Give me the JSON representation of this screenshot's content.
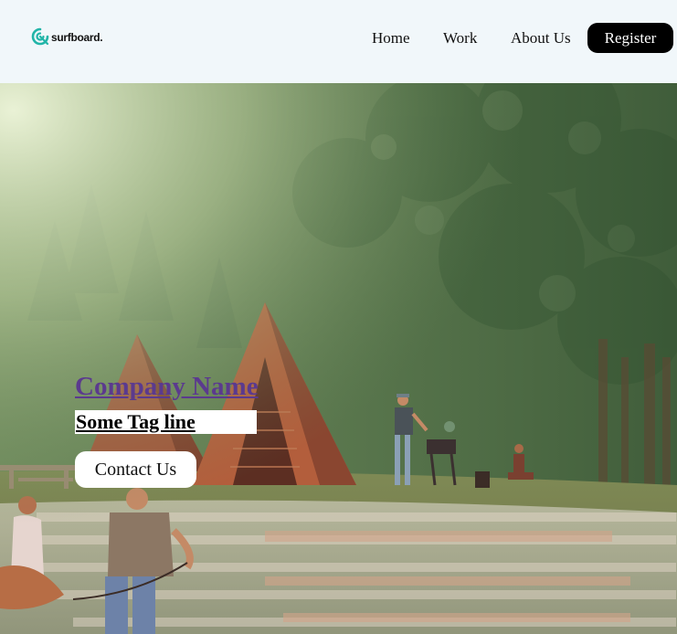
{
  "header": {
    "logo_text": "surfboard.",
    "nav": {
      "home": "Home",
      "work": "Work",
      "about": "About Us",
      "register": "Register"
    }
  },
  "hero": {
    "company_name": "Company Name",
    "tagline": "Some Tag line",
    "cta_label": "Contact Us",
    "background_illustration": "camping-scene"
  },
  "colors": {
    "header_bg": "#f1f7fa",
    "logo_accent": "#22b5a8",
    "register_bg": "#000000",
    "company_link": "#5b3a8e"
  }
}
